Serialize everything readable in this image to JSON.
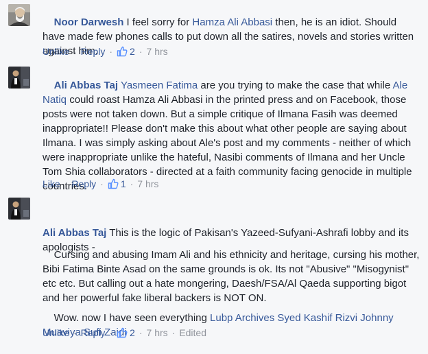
{
  "comments": [
    {
      "author": "Noor Darwesh",
      "segments": [
        {
          "t": " I feel sorry for ",
          "link": false
        },
        {
          "t": "Hamza Ali Abbasi",
          "link": true
        },
        {
          "t": " then, he is an idiot. Should have made few phones calls to put down all the satires, novels and stories written against him.",
          "link": false
        }
      ],
      "actions": {
        "like": "Unlike",
        "reply": "Reply",
        "likes": "2",
        "time": "7 hrs"
      }
    },
    {
      "author": "Ali Abbas Taj",
      "segments": [
        {
          "t": " ",
          "link": false
        },
        {
          "t": "Yasmeen Fatima",
          "link": true
        },
        {
          "t": " are you trying to make the case that while ",
          "link": false
        },
        {
          "t": "Ale Natiq",
          "link": true
        },
        {
          "t": " could roast Hamza Ali Abbasi in the printed press and on Facebook, those posts were not taken down. But a simple critique of Ilmana Fasih was deemed inappropriate!! Please don't make this about what other people are saying about Ilmana. I was simply asking about Ale's post and my comments - neither of which were inappropriate unlike the hateful, Nasibi comments of Ilmana and her Uncle Tom Shia collaborators - directed at a faith community facing genocide in multiple countries.",
          "link": false
        }
      ],
      "actions": {
        "like": "Like",
        "reply": "Reply",
        "likes": "1",
        "time": "7 hrs"
      }
    },
    {
      "author": "Ali Abbas Taj",
      "para1": " This is the logic of Pakisan's Yazeed-Sufyani-Ashrafi lobby and its apologists -",
      "para2": "Cursing and abusing Imam Ali and his ethnicity and heritage, cursing his mother, Bibi Fatima Binte Asad on the same grounds is ok. Its not \"Abusive\" \"Misogynist\" etc etc. But calling out a hate mongering, Daesh/FSA/Al Qaeda supporting bigot and her powerful fake liberal backers is NOT ON.",
      "para3_text": "Wow. now I have seen everything ",
      "para3_links": "Lubp Archives Syed Kashif Rizvi Johnny Muaviya Sufi Zaidi",
      "actions": {
        "like": "Unlike",
        "reply": "Reply",
        "likes": "2",
        "time": "7 hrs",
        "edited": "Edited"
      }
    }
  ],
  "colors": {
    "link": "#365899",
    "meta": "#90949c",
    "text": "#1d2129",
    "bg": "#f6f7f9"
  },
  "icons": [
    "avatar-photo",
    "like-thumb-icon"
  ]
}
